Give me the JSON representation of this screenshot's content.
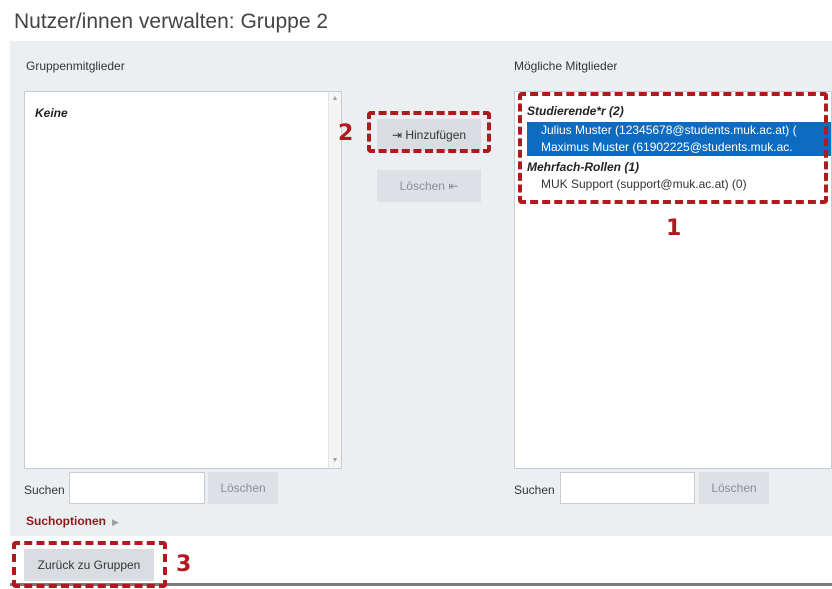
{
  "page": {
    "title": "Nutzer/innen verwalten: Gruppe 2"
  },
  "members": {
    "label": "Gruppenmitglieder",
    "empty_group": "Keine",
    "search_label": "Suchen",
    "search_value": "",
    "clear_button": "Löschen"
  },
  "potential": {
    "label": "Mögliche Mitglieder",
    "groups": [
      {
        "label": "Studierende*r (2)",
        "options": [
          {
            "text": "Julius Muster (12345678@students.muk.ac.at) (",
            "selected": true
          },
          {
            "text": "Maximus Muster (61902225@students.muk.ac.",
            "selected": true
          }
        ]
      },
      {
        "label": "Mehrfach-Rollen (1)",
        "options": [
          {
            "text": "MUK Support (support@muk.ac.at) (0)",
            "selected": false
          }
        ]
      }
    ],
    "search_label": "Suchen",
    "search_value": "",
    "clear_button": "Löschen"
  },
  "actions": {
    "add_button": "⇥ Hinzufügen",
    "remove_button": "Löschen ⇤"
  },
  "search_options": {
    "label": "Suchoptionen"
  },
  "back_button": "Zurück zu Gruppen",
  "annotations": {
    "marker_1": "1",
    "marker_2": "2",
    "marker_3": "3"
  },
  "colors": {
    "accent_red": "#b0191e",
    "selection_blue": "#0d6cc2",
    "link_red": "#8b1b1b"
  }
}
